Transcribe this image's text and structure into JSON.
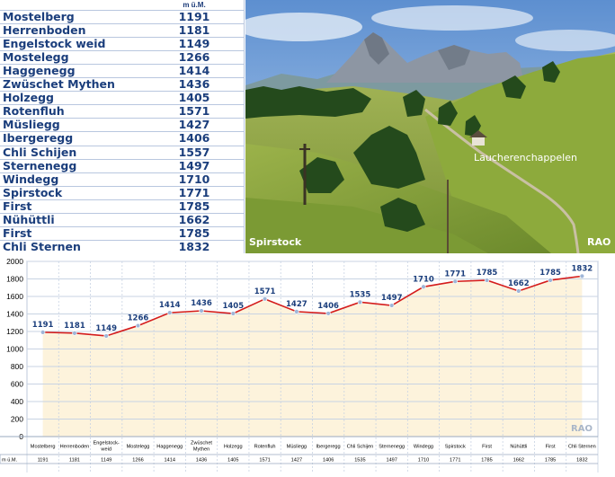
{
  "table": {
    "header": "m ü.M.",
    "rows": [
      {
        "name": "Mostelberg",
        "value": "1191"
      },
      {
        "name": "Herrenboden",
        "value": "1181"
      },
      {
        "name": "Engelstock weid",
        "value": "1149"
      },
      {
        "name": "Mostelegg",
        "value": "1266"
      },
      {
        "name": "Haggenegg",
        "value": "1414"
      },
      {
        "name": "Zwüschet Mythen",
        "value": "1436"
      },
      {
        "name": "Holzegg",
        "value": "1405"
      },
      {
        "name": "Rotenfluh",
        "value": "1571"
      },
      {
        "name": "Müsliegg",
        "value": "1427"
      },
      {
        "name": "Ibergeregg",
        "value": "1406"
      },
      {
        "name": "Chli Schijen",
        "value": "1557"
      },
      {
        "name": "Sternenegg",
        "value": "1497"
      },
      {
        "name": "Windegg",
        "value": "1710"
      },
      {
        "name": "Spirstock",
        "value": "1771"
      },
      {
        "name": "First",
        "value": "1785"
      },
      {
        "name": "Nühüttli",
        "value": "1662"
      },
      {
        "name": "First",
        "value": "1785"
      },
      {
        "name": "Chli Sternen",
        "value": "1832"
      }
    ]
  },
  "photo": {
    "label_left": "Spirstock",
    "label_chapel": "Laucherenchappelen",
    "label_right": "RAO"
  },
  "colors": {
    "line": "#d41c1c",
    "marker": "#9fb6d8",
    "fill": "#fdf3dc",
    "grid": "#c8d3e3",
    "text_blue": "#1b3e7c"
  },
  "chart_data": {
    "type": "area",
    "watermark": "RAO",
    "row_label": "m ü.M.",
    "ylim": [
      0,
      2000
    ],
    "yticks": [
      0,
      200,
      400,
      600,
      800,
      1000,
      1200,
      1400,
      1600,
      1800,
      2000
    ],
    "grid": true,
    "categories": [
      "Mostelberg",
      "Herrenboden",
      "Engelstock-weid",
      "Mostelegg",
      "Haggenegg",
      "Zwüschet Mythen",
      "Holzegg",
      "Rotenfluh",
      "Müsliegg",
      "Ibergeregg",
      "Chli Schijen",
      "Sternenegg",
      "Windegg",
      "Spirstock",
      "First",
      "Nühüttli",
      "First",
      "Chli Sternen"
    ],
    "series": [
      {
        "values": [
          1191,
          1181,
          1149,
          1266,
          1414,
          1436,
          1405,
          1571,
          1427,
          1406,
          1535,
          1497,
          1710,
          1771,
          1785,
          1662,
          1785,
          1832
        ]
      }
    ]
  }
}
